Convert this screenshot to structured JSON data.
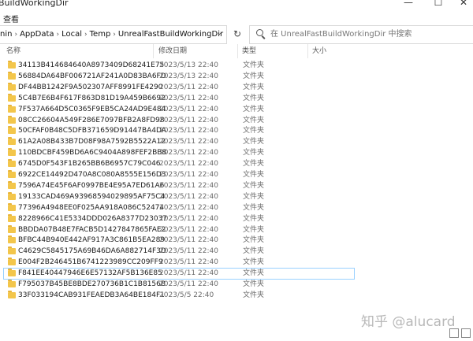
{
  "window": {
    "title": "BuildWorkingDir",
    "minimize": "—",
    "maximize": "☐",
    "close": "✕"
  },
  "menu": {
    "view": "查看"
  },
  "address": {
    "crumbs": [
      "nin",
      "AppData",
      "Local",
      "Temp",
      "UnrealFastBuildWorkingDir"
    ],
    "dropdown": "⌄",
    "refresh": "↻"
  },
  "search": {
    "placeholder": "在 UnrealFastBuildWorkingDir 中搜索"
  },
  "columns": {
    "name": "名称",
    "date": "修改日期",
    "type": "类型",
    "size": "大小"
  },
  "rows": [
    {
      "name": "34113B414684640A8973409D68241E75",
      "date": "2023/5/13 22:40",
      "type": "文件夹"
    },
    {
      "name": "56884DA64BF006721AF241A0D83BA6FD",
      "date": "2023/5/13 22:40",
      "type": "文件夹"
    },
    {
      "name": "DF44BB1242F9A502307AFF8991FE4290",
      "date": "2023/5/11 22:40",
      "type": "文件夹"
    },
    {
      "name": "5C4B7E6B4F617F863D81D19A459B6692",
      "date": "2023/5/11 22:40",
      "type": "文件夹"
    },
    {
      "name": "7F537A664D5C0365F9EB5CA24AD9E484",
      "date": "2023/5/11 22:40",
      "type": "文件夹"
    },
    {
      "name": "08CC26604A549F286E7097BFB2A8FD98",
      "date": "2023/5/11 22:40",
      "type": "文件夹"
    },
    {
      "name": "50CFAF0B48C5DFB371659D91447BA4DA",
      "date": "2023/5/11 22:40",
      "type": "文件夹"
    },
    {
      "name": "61A2A08B433B7D08F98A7592B5522A12",
      "date": "2023/5/11 22:40",
      "type": "文件夹"
    },
    {
      "name": "110BDCBF459BD6A6C9404A898FEF2BB8",
      "date": "2023/5/11 22:40",
      "type": "文件夹"
    },
    {
      "name": "6745D0F543F1B265BB6B6957C79C046",
      "date": "2023/5/11 22:40",
      "type": "文件夹"
    },
    {
      "name": "6922CE14492D470A8C080A8555E156D3",
      "date": "2023/5/11 22:40",
      "type": "文件夹"
    },
    {
      "name": "7596A74E45F6AF0997BE4E95A7ED61A6",
      "date": "2023/5/11 22:40",
      "type": "文件夹"
    },
    {
      "name": "19133CAD469A93968594029895AF75C4",
      "date": "2023/5/11 22:40",
      "type": "文件夹"
    },
    {
      "name": "77396A4948EE0F025AA918A086C52474",
      "date": "2023/5/11 22:40",
      "type": "文件夹"
    },
    {
      "name": "8228966C41E5334DDD026A8377D23037",
      "date": "2023/5/11 22:40",
      "type": "文件夹"
    },
    {
      "name": "BBDDA07B48E7FACB5D1427847865FAE2",
      "date": "2023/5/11 22:40",
      "type": "文件夹"
    },
    {
      "name": "BFBC44B940E442AF917A3C861B5EA289",
      "date": "2023/5/11 22:40",
      "type": "文件夹"
    },
    {
      "name": "C4629C5845175A69B46DA6A882714F3D",
      "date": "2023/5/11 22:40",
      "type": "文件夹"
    },
    {
      "name": "E004F2B246451B6741223989CC209FF9",
      "date": "2023/5/11 22:40",
      "type": "文件夹"
    },
    {
      "name": "F841EE40447946E6E57132AF5B136E85",
      "date": "2023/5/11 22:40",
      "type": "文件夹",
      "selected": true
    },
    {
      "name": "F795037B45BE8BDE270736B1C1B8156B",
      "date": "2023/5/11 22:40",
      "type": "文件夹"
    },
    {
      "name": "33F033194CAB931FEAEDB3A64BE184F1",
      "date": "2023/5/5 22:40",
      "type": "文件夹"
    }
  ],
  "watermark": "知乎 @alucard",
  "colors": {
    "folder": "#f3c64b",
    "selection_border": "#99d1ff"
  },
  "icons": {
    "folder": "folder-icon",
    "search": "search-icon",
    "refresh": "refresh-icon"
  }
}
